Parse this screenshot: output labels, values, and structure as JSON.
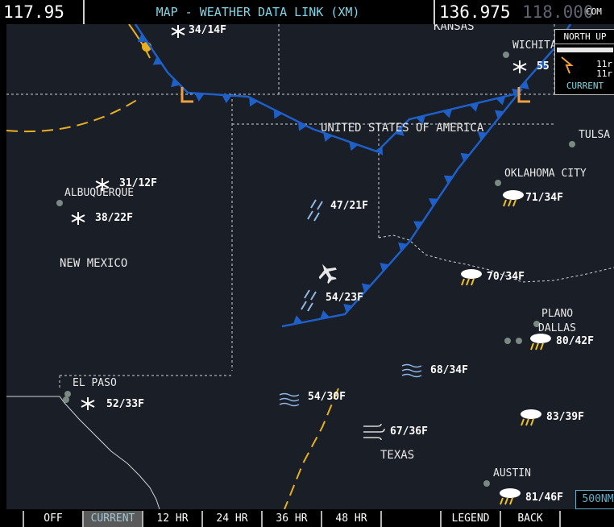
{
  "top_bar": {
    "left_freq": "117.95",
    "title": "MAP - WEATHER DATA LINK (XM)",
    "active_freq": "136.975",
    "standby_freq": "118.000",
    "com_label": "COM"
  },
  "map": {
    "states": [
      "NEW MEXICO",
      "TEXAS",
      "KANSAS",
      "UNITED STATES OF AMERICA"
    ],
    "cities": [
      {
        "name": "ALBUQUERQUE"
      },
      {
        "name": "EL PASO"
      },
      {
        "name": "WICHITA"
      },
      {
        "name": "TULSA"
      },
      {
        "name": "OKLAHOMA CITY"
      },
      {
        "name": "PLANO"
      },
      {
        "name": "DALLAS"
      },
      {
        "name": "AUSTIN"
      }
    ],
    "weather": [
      {
        "icon": "snow-icon",
        "text": "34/14F"
      },
      {
        "icon": "snow-icon",
        "text": "55"
      },
      {
        "icon": "snow-icon",
        "text": "31/12F"
      },
      {
        "icon": "snow-icon",
        "text": "38/22F"
      },
      {
        "icon": "rain-icon",
        "text": "47/21F"
      },
      {
        "icon": "rain-icon",
        "text": "54/23F"
      },
      {
        "icon": "thunderstorm-icon",
        "text": "71/34F"
      },
      {
        "icon": "thunderstorm-icon",
        "text": "70/34F"
      },
      {
        "icon": "thunderstorm-icon",
        "text": "80/42F"
      },
      {
        "icon": "haze-icon",
        "text": "68/34F"
      },
      {
        "icon": "haze-icon",
        "text": "54/30F"
      },
      {
        "icon": "snow-icon",
        "text": "52/33F"
      },
      {
        "icon": "thunderstorm-icon",
        "text": "83/39F"
      },
      {
        "icon": "wind-icon",
        "text": "67/36F"
      },
      {
        "icon": "thunderstorm-icon",
        "text": "81/46F"
      }
    ],
    "low_marker": "L",
    "ownship_icon": "airplane-icon"
  },
  "inset": {
    "orientation": "NORTH UP",
    "line1": "11r",
    "line2": "11r",
    "status": "CURRENT"
  },
  "map_scale": "500NM",
  "softkeys": [
    "OFF",
    "CURRENT",
    "12 HR",
    "24 HR",
    "36 HR",
    "48 HR",
    "",
    "LEGEND",
    "BACK",
    ""
  ],
  "colors": {
    "title_cyan": "#7fd6e6",
    "front_blue": "#1e5fc8",
    "boundary_yellow": "#e8b020",
    "low_orange": "#f0a040",
    "map_background": "#1a1e26"
  }
}
